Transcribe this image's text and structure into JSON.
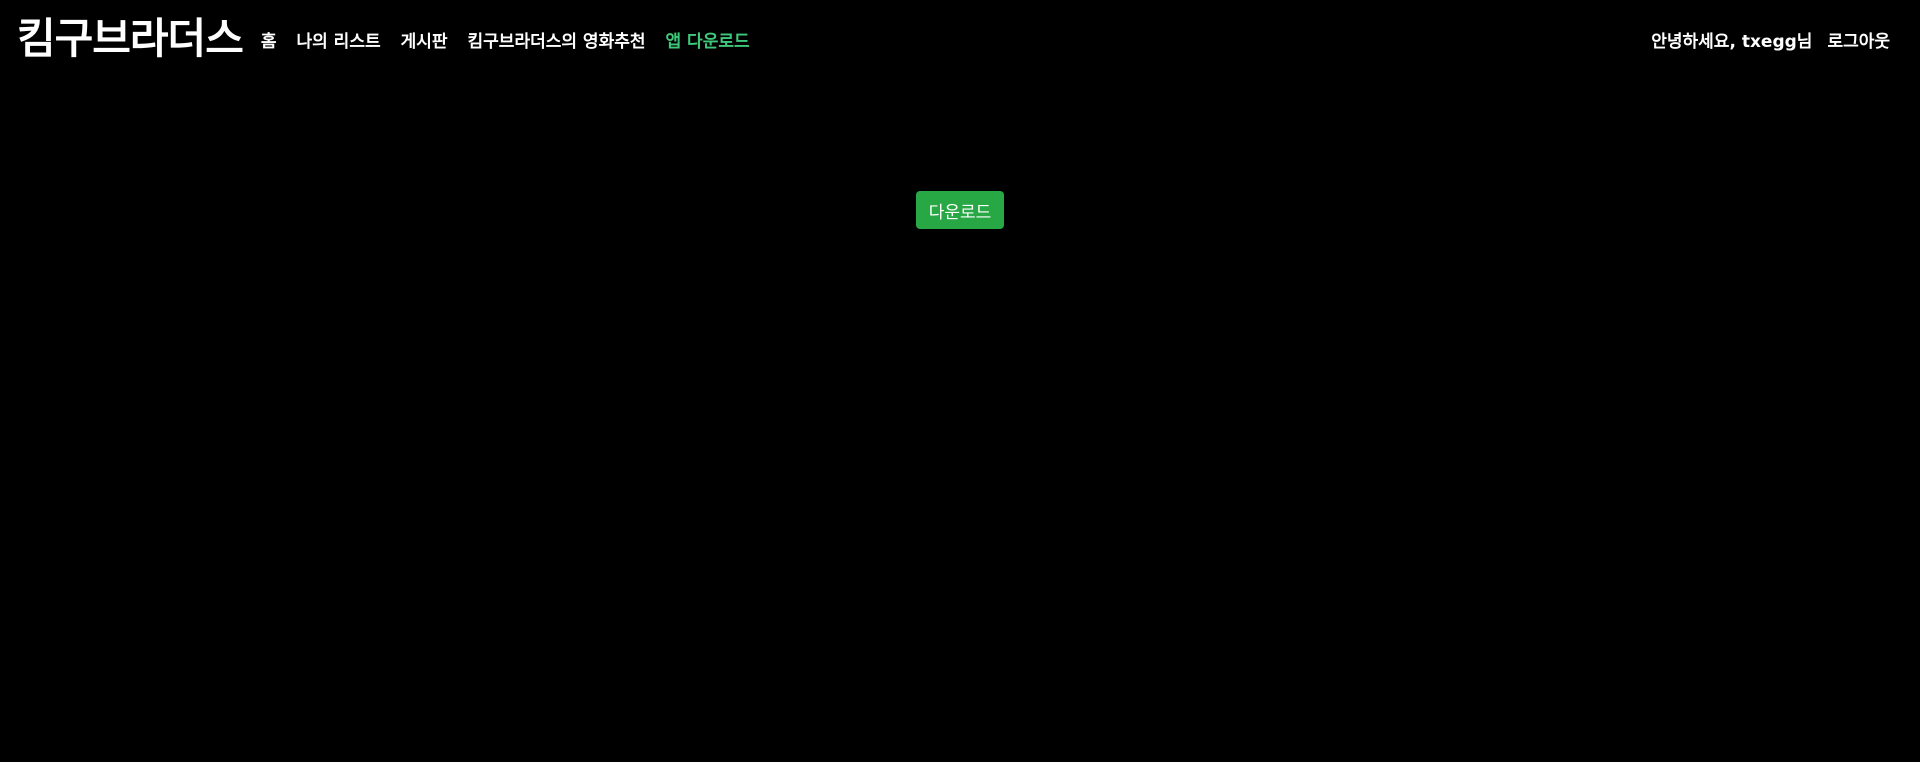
{
  "navbar": {
    "brand": "킴구브라더스",
    "links": [
      {
        "label": "홈",
        "active": false
      },
      {
        "label": "나의 리스트",
        "active": false
      },
      {
        "label": "게시판",
        "active": false
      },
      {
        "label": "킴구브라더스의 영화추천",
        "active": false
      },
      {
        "label": "앱 다운로드",
        "active": true
      }
    ],
    "greeting": "안녕하세요, txegg님",
    "logout_label": "로그아웃"
  },
  "main": {
    "download_label": "다운로드"
  },
  "colors": {
    "background": "#000000",
    "text": "#ffffff",
    "active_link": "#3ec97a",
    "download_button": "#28a745"
  }
}
